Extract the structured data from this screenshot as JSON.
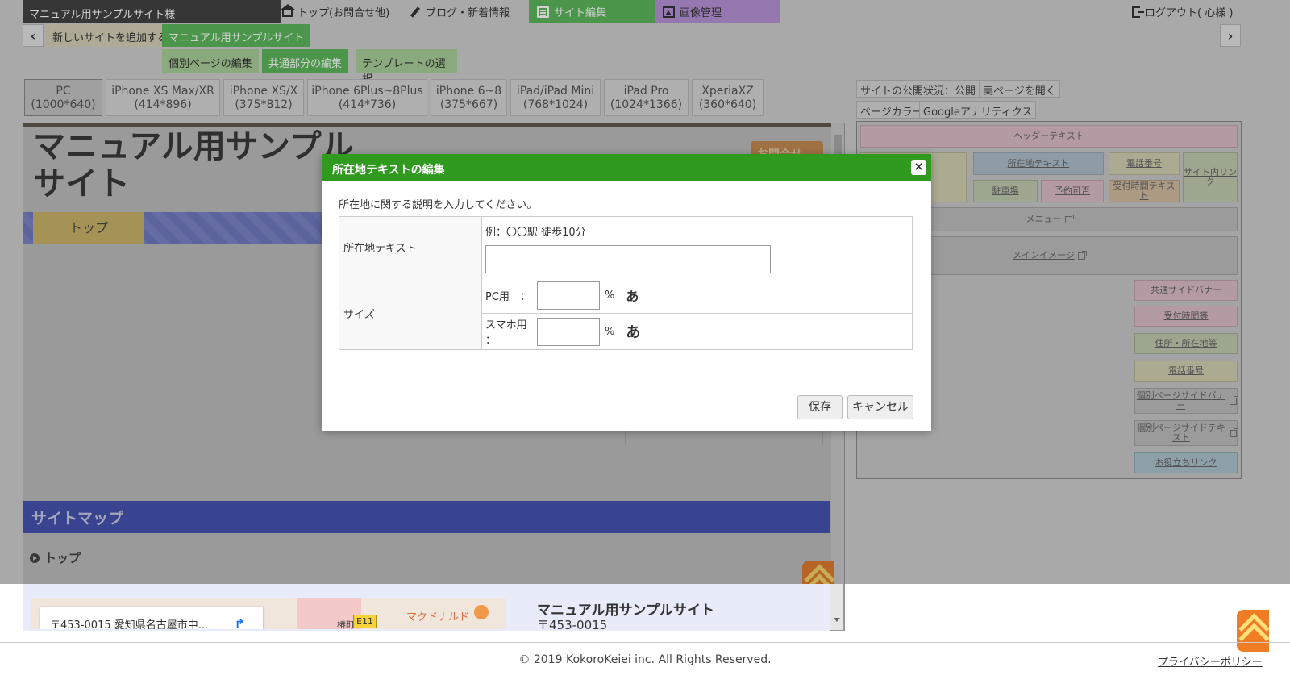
{
  "topnav": {
    "site_name": "マニュアル用サンプルサイト様",
    "tabs": [
      {
        "label": "トップ(お問合せ他)",
        "icon": "home-icon"
      },
      {
        "label": "ブログ・新着情報",
        "icon": "pen-icon"
      },
      {
        "label": "サイト編集",
        "icon": "document-icon"
      },
      {
        "label": "画像管理",
        "icon": "image-icon"
      }
    ],
    "logout": "ログアウト( 心様 )"
  },
  "sitebar": {
    "add_site": "新しいサイトを追加する",
    "current_site": "マニュアル用サンプルサイト",
    "sub_tabs": [
      "個別ページの編集",
      "共通部分の編集",
      "テンプレートの選択"
    ]
  },
  "devices": [
    {
      "name": "PC",
      "size": "(1000*640)"
    },
    {
      "name": "iPhone XS Max/XR",
      "size": "(414*896)"
    },
    {
      "name": "iPhone XS/X",
      "size": "(375*812)"
    },
    {
      "name": "iPhone 6Plus~8Plus",
      "size": "(414*736)"
    },
    {
      "name": "iPhone 6~8",
      "size": "(375*667)"
    },
    {
      "name": "iPad/iPad Mini",
      "size": "(768*1024)"
    },
    {
      "name": "iPad Pro",
      "size": "(1024*1366)"
    },
    {
      "name": "XperiaXZ",
      "size": "(360*640)"
    }
  ],
  "preview": {
    "title": "マニュアル用サンプルサイト",
    "ask_button": "お問合せ",
    "nav_top": "トップ",
    "sitemap": "サイトマップ",
    "sitemap_top": "トップ",
    "map_address": "〒453-0015 愛知県名古屋市中...",
    "map_label_e11": "E11",
    "map_label_mcd": "マクドナルド",
    "map_label_town": "椿町",
    "site_info_name": "マニュアル用サンプルサイト",
    "site_info_zip": "〒453-0015"
  },
  "right_panel": {
    "status": "サイトの公開状況：公開",
    "open_page": "実ページを開く",
    "page_color": "ページカラー",
    "analytics": "Googleアナリティクス",
    "blocks": {
      "header_text": "ヘッダーテキスト",
      "address_text": "所在地テキスト",
      "phone": "電話番号",
      "site_link": "サイト内リンク",
      "parking": "駐車場",
      "reservation": "予約可否",
      "reception_text": "受付時間テキスト",
      "menu": "メニュー",
      "main_image": "メインイメージ",
      "common_side_banner": "共通サイドバナー",
      "reception_hours": "受付時間等",
      "address_etc": "住所・所在地等",
      "phone2": "電話番号",
      "page_side_banner": "個別ページサイドバナー",
      "page_side_text": "個別ページサイドテキスト",
      "useful_links": "お役立ちリンク"
    }
  },
  "modal": {
    "title": "所在地テキストの編集",
    "close": "×",
    "description": "所在地に関する説明を入力してください。",
    "address_label": "所在地テキスト",
    "address_hint": "例：〇〇駅 徒歩10分",
    "address_value": "",
    "size_label": "サイズ",
    "pc_label": "PC用　：",
    "sp_label": "スマホ用 ：",
    "pc_value": "",
    "sp_value": "",
    "percent": "%",
    "sample_glyph": "あ",
    "save": "保存",
    "cancel": "キャンセル"
  },
  "footer": {
    "copyright": "© 2019 KokoroKeiei inc. All Rights Reserved.",
    "privacy": "プライバシーポリシー"
  }
}
